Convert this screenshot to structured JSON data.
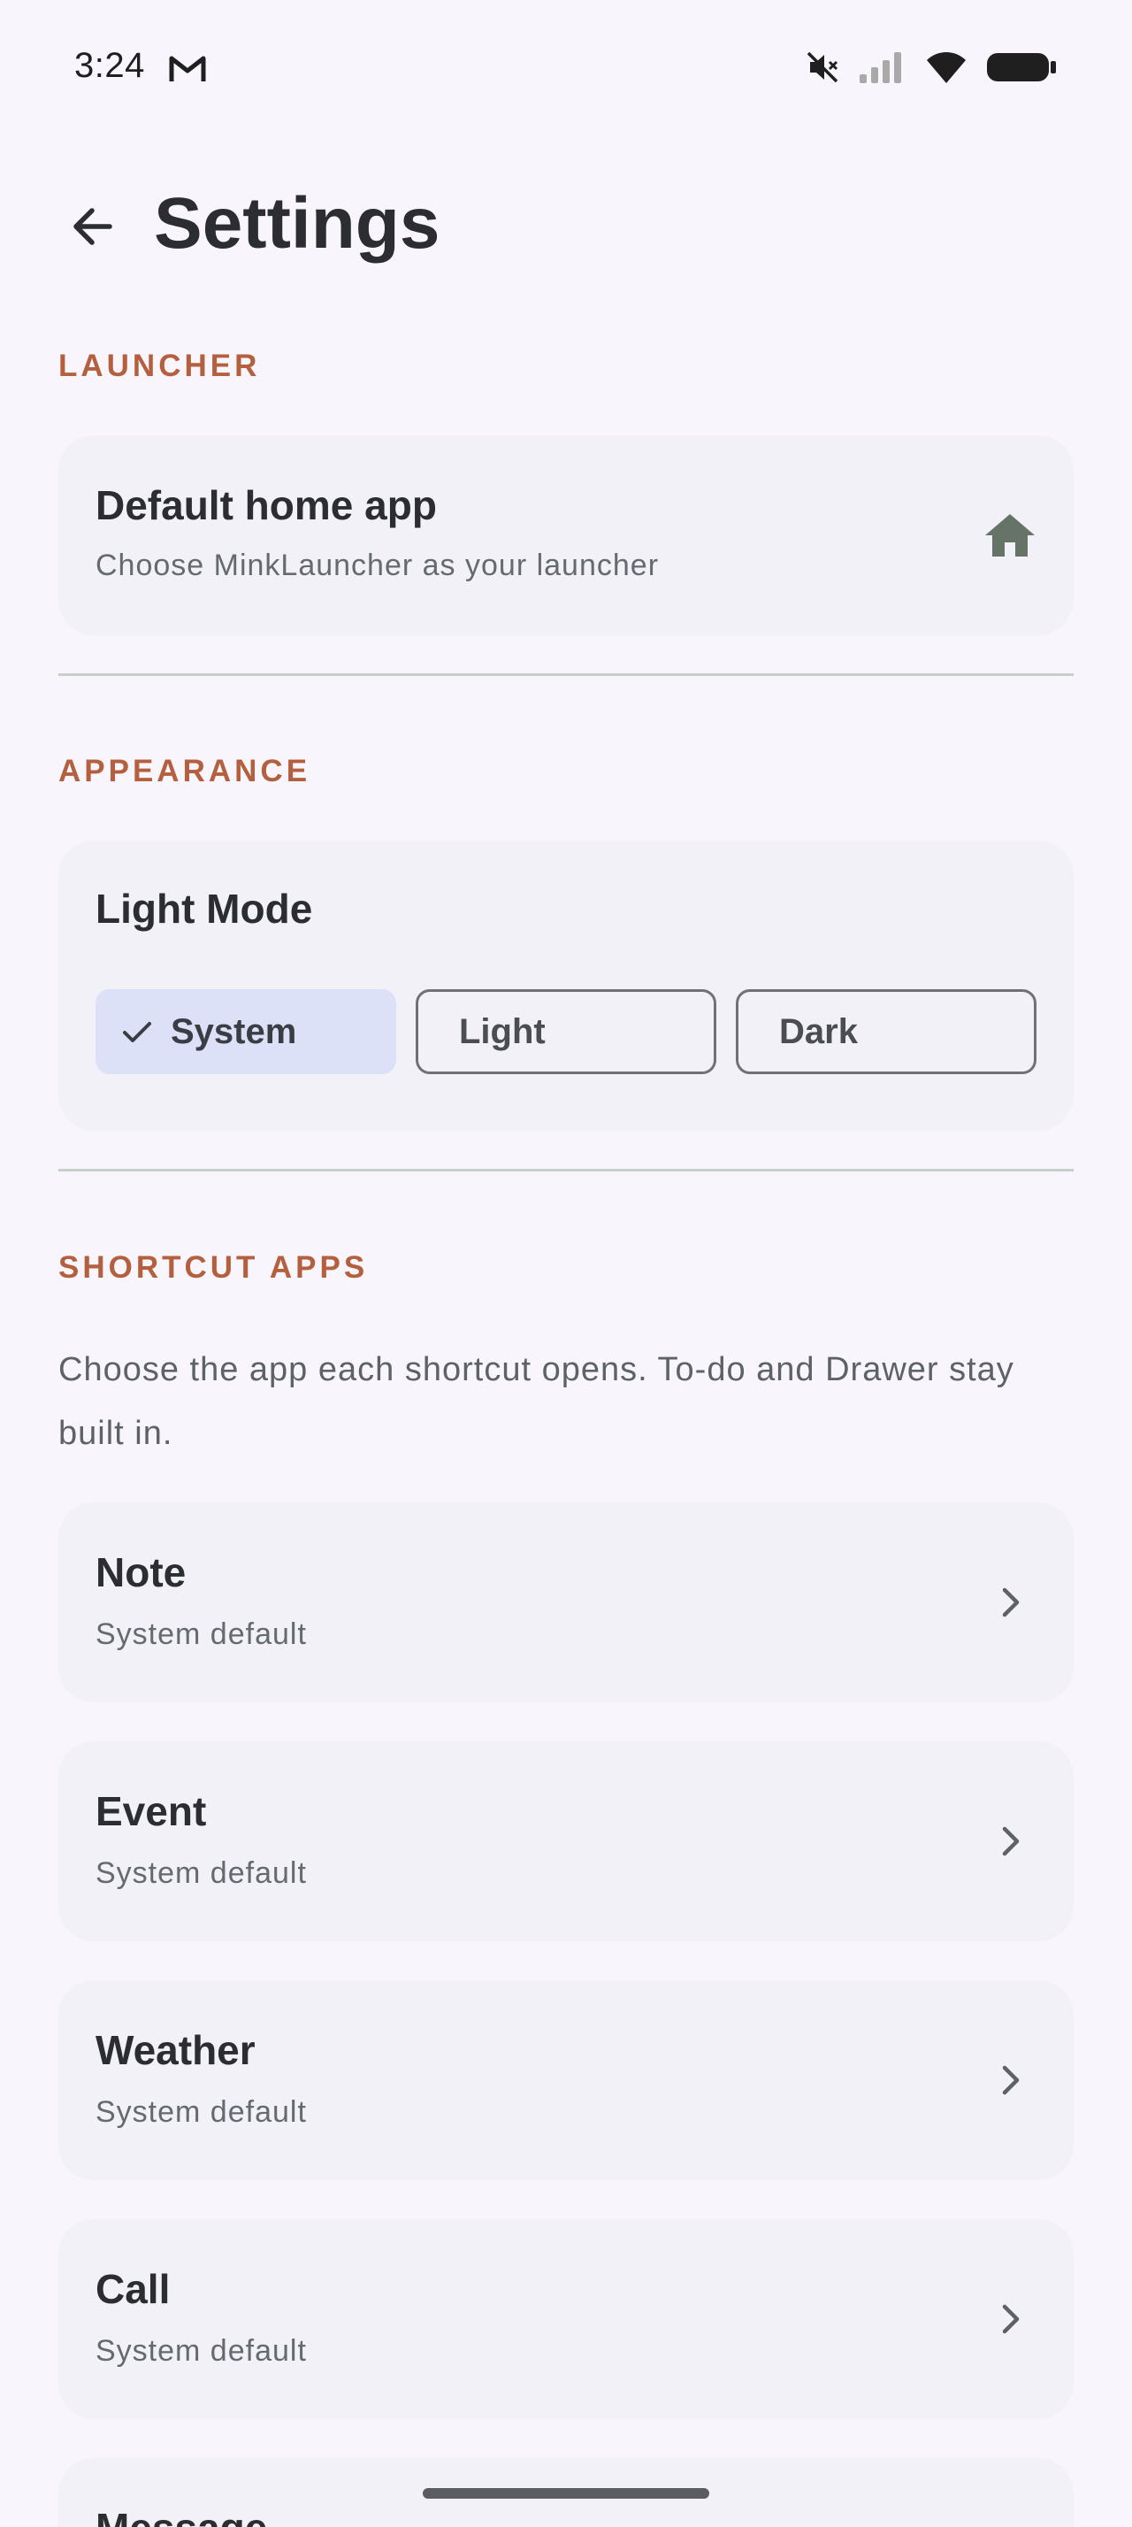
{
  "status_bar": {
    "time": "3:24",
    "notification_icon": "gmail-icon",
    "icons": [
      "mute-icon",
      "signal-icon",
      "wifi-icon",
      "battery-icon"
    ]
  },
  "header": {
    "back_icon": "arrow-back-icon",
    "title": "Settings"
  },
  "sections": {
    "launcher": {
      "header": "LAUNCHER",
      "item": {
        "title": "Default home app",
        "subtitle": "Choose MinkLauncher as your launcher",
        "icon": "home-icon"
      }
    },
    "appearance": {
      "header": "APPEARANCE",
      "title": "Light Mode",
      "options": [
        "System",
        "Light",
        "Dark"
      ],
      "selected": "System"
    },
    "shortcut_apps": {
      "header": "SHORTCUT APPS",
      "description": "Choose the app each shortcut opens. To-do and Drawer stay built in.",
      "items": [
        {
          "title": "Note",
          "subtitle": "System default"
        },
        {
          "title": "Event",
          "subtitle": "System default"
        },
        {
          "title": "Weather",
          "subtitle": "System default"
        },
        {
          "title": "Call",
          "subtitle": "System default"
        },
        {
          "title": "Message",
          "subtitle": ""
        }
      ]
    }
  },
  "colors": {
    "background": "#f8f6fc",
    "accent": "#b4603e",
    "card": "#f1f1f7",
    "selected_segment": "#dde1f7"
  }
}
